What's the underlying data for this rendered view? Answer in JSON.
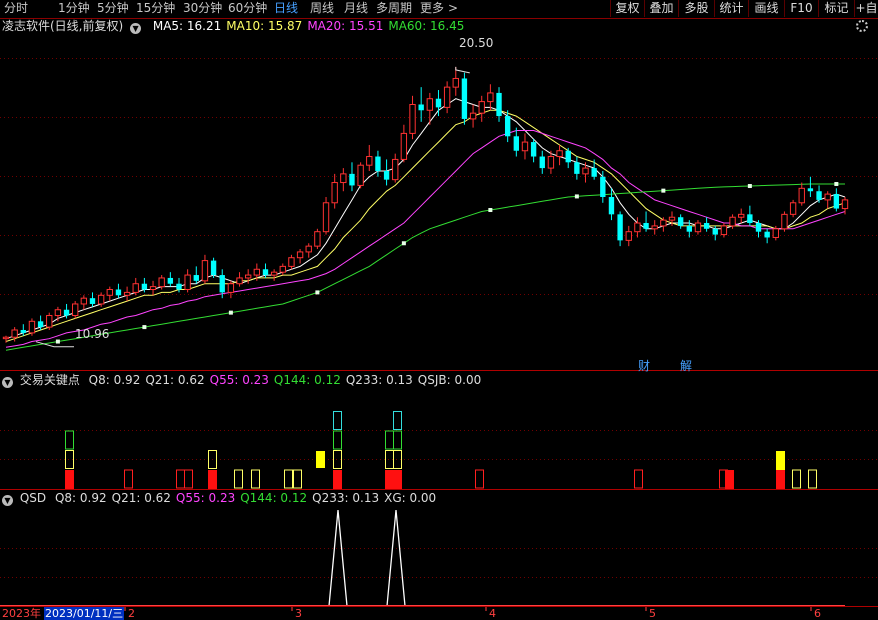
{
  "toolbar": {
    "periods": [
      "分时",
      "1分钟",
      "5分钟",
      "15分钟",
      "30分钟",
      "60分钟",
      "日线",
      "周线",
      "月线",
      "多周期",
      "更多"
    ],
    "active_period": "日线",
    "more_arrow": ">",
    "buttons": [
      "复权",
      "叠加",
      "多股",
      "统计",
      "画线",
      "F10",
      "标记"
    ],
    "overflow": "+自"
  },
  "main_panel": {
    "title": "凌志软件(日线,前复权)",
    "indicators": [
      {
        "label": "MA5: 16.21",
        "color": "#ffffff"
      },
      {
        "label": "MA10: 15.87",
        "color": "#ffff66"
      },
      {
        "label": "MA20: 15.51",
        "color": "#ff44ff"
      },
      {
        "label": "MA60: 16.45",
        "color": "#33dd33"
      }
    ],
    "high_label": "20.50",
    "low_label": "10.96",
    "markers": [
      "财",
      "解"
    ]
  },
  "panel2": {
    "title": "交易关键点",
    "indicators": [
      {
        "label": "Q8: 0.92",
        "color": "#dddddd"
      },
      {
        "label": "Q21: 0.62",
        "color": "#dddddd"
      },
      {
        "label": "Q55: 0.23",
        "color": "#ff44ff"
      },
      {
        "label": "Q144: 0.12",
        "color": "#33dd33"
      },
      {
        "label": "Q233: 0.13",
        "color": "#dddddd"
      },
      {
        "label": "QSJB: 0.00",
        "color": "#dddddd"
      }
    ]
  },
  "panel3": {
    "title": "QSD",
    "indicators": [
      {
        "label": "Q8: 0.92",
        "color": "#dddddd"
      },
      {
        "label": "Q21: 0.62",
        "color": "#dddddd"
      },
      {
        "label": "Q55: 0.23",
        "color": "#ff44ff"
      },
      {
        "label": "Q144: 0.12",
        "color": "#33dd33"
      },
      {
        "label": "Q233: 0.13",
        "color": "#dddddd"
      },
      {
        "label": "XG: 0.00",
        "color": "#dddddd"
      }
    ]
  },
  "axis": {
    "year": "2023年",
    "cursor_date": "2023/01/11/三",
    "months": [
      "2",
      "3",
      "4",
      "5",
      "6"
    ]
  },
  "colors": {
    "up": "#ff3232",
    "down": "#00ffff",
    "ma5": "#ffffff",
    "ma10": "#ffff66",
    "ma20": "#ff44ff",
    "ma60": "#33dd33",
    "grid": "#700000",
    "accent": "#46a0ff"
  },
  "chart_data": {
    "type": "candlestick",
    "title": "凌志软件(日线,前复权)",
    "y_range": [
      10.5,
      21.5
    ],
    "ohlc": [
      [
        11.1,
        11.2,
        10.96,
        11.15
      ],
      [
        11.15,
        11.5,
        11.0,
        11.4
      ],
      [
        11.4,
        11.6,
        11.2,
        11.3
      ],
      [
        11.3,
        11.8,
        11.2,
        11.7
      ],
      [
        11.7,
        11.9,
        11.4,
        11.5
      ],
      [
        11.5,
        12.0,
        11.4,
        11.9
      ],
      [
        11.9,
        12.2,
        11.7,
        12.1
      ],
      [
        12.1,
        12.3,
        11.8,
        11.9
      ],
      [
        11.9,
        12.4,
        11.8,
        12.3
      ],
      [
        12.3,
        12.6,
        12.1,
        12.5
      ],
      [
        12.5,
        12.7,
        12.2,
        12.3
      ],
      [
        12.3,
        12.7,
        12.2,
        12.6
      ],
      [
        12.6,
        12.9,
        12.4,
        12.8
      ],
      [
        12.8,
        13.0,
        12.5,
        12.6
      ],
      [
        12.6,
        12.9,
        12.4,
        12.7
      ],
      [
        12.7,
        13.2,
        12.6,
        13.0
      ],
      [
        13.0,
        13.2,
        12.7,
        12.8
      ],
      [
        12.8,
        13.1,
        12.6,
        12.9
      ],
      [
        12.9,
        13.3,
        12.8,
        13.2
      ],
      [
        13.2,
        13.4,
        12.9,
        13.0
      ],
      [
        13.0,
        13.2,
        12.7,
        12.8
      ],
      [
        12.8,
        13.5,
        12.7,
        13.3
      ],
      [
        13.3,
        13.6,
        13.0,
        13.1
      ],
      [
        13.1,
        14.0,
        13.0,
        13.8
      ],
      [
        13.8,
        13.9,
        13.2,
        13.3
      ],
      [
        13.3,
        13.5,
        12.5,
        12.7
      ],
      [
        12.7,
        13.1,
        12.5,
        13.0
      ],
      [
        13.0,
        13.4,
        12.9,
        13.2
      ],
      [
        13.2,
        13.5,
        13.0,
        13.3
      ],
      [
        13.3,
        13.7,
        13.1,
        13.5
      ],
      [
        13.5,
        13.7,
        13.2,
        13.3
      ],
      [
        13.3,
        13.5,
        13.1,
        13.4
      ],
      [
        13.4,
        13.7,
        13.3,
        13.6
      ],
      [
        13.6,
        14.0,
        13.5,
        13.9
      ],
      [
        13.9,
        14.2,
        13.7,
        14.1
      ],
      [
        14.1,
        14.4,
        13.9,
        14.3
      ],
      [
        14.3,
        14.9,
        14.2,
        14.8
      ],
      [
        14.8,
        16.0,
        14.7,
        15.8
      ],
      [
        15.8,
        16.8,
        15.6,
        16.5
      ],
      [
        16.5,
        17.0,
        16.2,
        16.8
      ],
      [
        16.8,
        17.2,
        16.2,
        16.4
      ],
      [
        16.4,
        17.2,
        16.3,
        17.1
      ],
      [
        17.1,
        17.8,
        16.9,
        17.4
      ],
      [
        17.4,
        17.6,
        16.7,
        16.9
      ],
      [
        16.9,
        17.3,
        16.4,
        16.6
      ],
      [
        16.6,
        17.5,
        16.5,
        17.3
      ],
      [
        17.3,
        18.5,
        17.2,
        18.2
      ],
      [
        18.2,
        19.5,
        18.0,
        19.2
      ],
      [
        19.2,
        19.8,
        18.6,
        19.0
      ],
      [
        19.0,
        19.6,
        18.5,
        19.4
      ],
      [
        19.4,
        19.7,
        18.8,
        19.1
      ],
      [
        19.1,
        20.0,
        18.9,
        19.8
      ],
      [
        19.8,
        20.5,
        19.5,
        20.1
      ],
      [
        20.1,
        20.3,
        18.5,
        18.7
      ],
      [
        18.7,
        19.2,
        18.4,
        18.9
      ],
      [
        18.9,
        19.5,
        18.6,
        19.3
      ],
      [
        19.3,
        19.9,
        19.0,
        19.6
      ],
      [
        19.6,
        19.8,
        18.6,
        18.8
      ],
      [
        18.8,
        19.0,
        17.9,
        18.1
      ],
      [
        18.1,
        18.4,
        17.4,
        17.6
      ],
      [
        17.6,
        18.2,
        17.3,
        17.9
      ],
      [
        17.9,
        18.0,
        17.2,
        17.4
      ],
      [
        17.4,
        17.6,
        16.8,
        17.0
      ],
      [
        17.0,
        17.6,
        16.8,
        17.4
      ],
      [
        17.4,
        17.8,
        17.1,
        17.6
      ],
      [
        17.6,
        17.7,
        17.0,
        17.2
      ],
      [
        17.2,
        17.4,
        16.6,
        16.8
      ],
      [
        16.8,
        17.2,
        16.5,
        17.0
      ],
      [
        17.0,
        17.3,
        16.6,
        16.7
      ],
      [
        16.7,
        16.9,
        15.8,
        16.0
      ],
      [
        16.0,
        16.3,
        15.2,
        15.4
      ],
      [
        15.4,
        15.5,
        14.3,
        14.5
      ],
      [
        14.5,
        15.0,
        14.3,
        14.8
      ],
      [
        14.8,
        15.3,
        14.6,
        15.1
      ],
      [
        15.1,
        15.5,
        14.8,
        14.9
      ],
      [
        14.9,
        15.2,
        14.7,
        15.0
      ],
      [
        15.0,
        15.3,
        14.8,
        15.2
      ],
      [
        15.2,
        15.5,
        15.0,
        15.3
      ],
      [
        15.3,
        15.4,
        14.9,
        15.0
      ],
      [
        15.0,
        15.2,
        14.6,
        14.8
      ],
      [
        14.8,
        15.2,
        14.7,
        15.1
      ],
      [
        15.1,
        15.3,
        14.8,
        14.9
      ],
      [
        14.9,
        15.0,
        14.5,
        14.7
      ],
      [
        14.7,
        15.1,
        14.6,
        15.0
      ],
      [
        15.0,
        15.4,
        14.9,
        15.3
      ],
      [
        15.3,
        15.6,
        15.1,
        15.4
      ],
      [
        15.4,
        15.7,
        15.0,
        15.1
      ],
      [
        15.1,
        15.2,
        14.6,
        14.8
      ],
      [
        14.8,
        14.9,
        14.4,
        14.6
      ],
      [
        14.6,
        15.0,
        14.5,
        14.9
      ],
      [
        14.9,
        15.5,
        14.8,
        15.4
      ],
      [
        15.4,
        15.9,
        15.3,
        15.8
      ],
      [
        15.8,
        16.5,
        15.7,
        16.3
      ],
      [
        16.3,
        16.7,
        16.0,
        16.2
      ],
      [
        16.2,
        16.4,
        15.8,
        15.9
      ],
      [
        15.9,
        16.2,
        15.6,
        16.1
      ],
      [
        16.1,
        16.3,
        15.5,
        15.6
      ],
      [
        15.6,
        16.0,
        15.4,
        15.9
      ]
    ],
    "series": [
      {
        "name": "MA5",
        "values": [
          11.1,
          11.2,
          11.3,
          11.4,
          11.5,
          11.6,
          11.8,
          11.9,
          12.0,
          12.1,
          12.2,
          12.3,
          12.4,
          12.5,
          12.6,
          12.7,
          12.8,
          12.8,
          12.9,
          12.9,
          12.9,
          13.0,
          13.0,
          13.2,
          13.3,
          13.2,
          13.1,
          13.0,
          13.1,
          13.2,
          13.3,
          13.3,
          13.4,
          13.5,
          13.6,
          13.8,
          14.0,
          14.4,
          14.9,
          15.4,
          15.9,
          16.4,
          16.7,
          16.9,
          16.9,
          17.0,
          17.3,
          17.8,
          18.2,
          18.6,
          19.0,
          19.2,
          19.4,
          19.3,
          19.2,
          19.1,
          19.1,
          19.0,
          18.8,
          18.6,
          18.3,
          18.0,
          17.7,
          17.5,
          17.4,
          17.3,
          17.2,
          17.1,
          17.0,
          16.7,
          16.3,
          15.8,
          15.4,
          15.1,
          14.9,
          14.9,
          15.0,
          15.1,
          15.1,
          15.1,
          15.0,
          15.0,
          14.9,
          14.9,
          15.0,
          15.1,
          15.2,
          15.1,
          15.0,
          14.9,
          14.9,
          15.1,
          15.4,
          15.7,
          15.9,
          16.0,
          16.1,
          16.0
        ]
      },
      {
        "name": "MA10",
        "values": [
          11.0,
          11.1,
          11.2,
          11.3,
          11.4,
          11.5,
          11.6,
          11.7,
          11.8,
          11.9,
          12.0,
          12.1,
          12.2,
          12.3,
          12.4,
          12.5,
          12.6,
          12.6,
          12.7,
          12.7,
          12.8,
          12.8,
          12.9,
          13.0,
          13.0,
          13.0,
          13.0,
          13.1,
          13.1,
          13.2,
          13.2,
          13.2,
          13.3,
          13.3,
          13.4,
          13.5,
          13.6,
          13.9,
          14.2,
          14.6,
          14.9,
          15.2,
          15.6,
          15.9,
          16.2,
          16.4,
          16.7,
          17.0,
          17.3,
          17.6,
          17.9,
          18.2,
          18.5,
          18.6,
          18.8,
          18.9,
          19.0,
          19.0,
          18.9,
          18.8,
          18.6,
          18.4,
          18.2,
          18.0,
          17.8,
          17.6,
          17.4,
          17.3,
          17.2,
          17.0,
          16.8,
          16.5,
          16.2,
          15.9,
          15.6,
          15.4,
          15.2,
          15.1,
          15.0,
          15.0,
          15.0,
          15.0,
          15.0,
          15.0,
          15.0,
          15.0,
          15.0,
          15.0,
          15.0,
          14.9,
          14.9,
          15.0,
          15.1,
          15.3,
          15.4,
          15.6,
          15.7,
          15.8
        ]
      },
      {
        "name": "MA20",
        "values": [
          10.8,
          10.85,
          10.9,
          11.0,
          11.05,
          11.1,
          11.2,
          11.3,
          11.35,
          11.4,
          11.5,
          11.6,
          11.65,
          11.75,
          11.85,
          11.9,
          12.0,
          12.1,
          12.15,
          12.25,
          12.3,
          12.4,
          12.45,
          12.55,
          12.6,
          12.65,
          12.7,
          12.75,
          12.8,
          12.85,
          12.9,
          12.95,
          13.0,
          13.05,
          13.1,
          13.15,
          13.25,
          13.35,
          13.5,
          13.7,
          13.9,
          14.1,
          14.3,
          14.5,
          14.7,
          14.9,
          15.1,
          15.4,
          15.7,
          16.0,
          16.3,
          16.6,
          16.9,
          17.2,
          17.5,
          17.7,
          17.9,
          18.1,
          18.2,
          18.3,
          18.3,
          18.3,
          18.2,
          18.1,
          18.0,
          17.9,
          17.8,
          17.7,
          17.5,
          17.3,
          17.0,
          16.8,
          16.5,
          16.3,
          16.1,
          15.9,
          15.8,
          15.7,
          15.6,
          15.5,
          15.4,
          15.3,
          15.2,
          15.1,
          15.1,
          15.0,
          15.0,
          14.9,
          14.9,
          14.9,
          14.9,
          14.9,
          15.0,
          15.1,
          15.2,
          15.3,
          15.4,
          15.5
        ]
      },
      {
        "name": "MA60",
        "values": [
          10.7,
          10.75,
          10.8,
          10.85,
          10.9,
          10.95,
          11.0,
          11.05,
          11.1,
          11.15,
          11.2,
          11.25,
          11.3,
          11.35,
          11.4,
          11.45,
          11.5,
          11.55,
          11.6,
          11.65,
          11.7,
          11.75,
          11.8,
          11.85,
          11.9,
          11.95,
          12.0,
          12.05,
          12.1,
          12.15,
          12.2,
          12.25,
          12.3,
          12.4,
          12.5,
          12.6,
          12.7,
          12.85,
          13.0,
          13.15,
          13.3,
          13.45,
          13.6,
          13.8,
          14.0,
          14.2,
          14.4,
          14.6,
          14.75,
          14.9,
          15.0,
          15.1,
          15.2,
          15.3,
          15.4,
          15.5,
          15.55,
          15.6,
          15.65,
          15.7,
          15.75,
          15.8,
          15.85,
          15.9,
          15.95,
          16.0,
          16.02,
          16.04,
          16.06,
          16.08,
          16.1,
          16.12,
          16.14,
          16.16,
          16.18,
          16.2,
          16.22,
          16.24,
          16.26,
          16.28,
          16.3,
          16.32,
          16.34,
          16.35,
          16.36,
          16.37,
          16.38,
          16.39,
          16.4,
          16.41,
          16.42,
          16.43,
          16.44,
          16.45,
          16.45,
          16.45,
          16.45,
          16.45
        ]
      }
    ]
  }
}
